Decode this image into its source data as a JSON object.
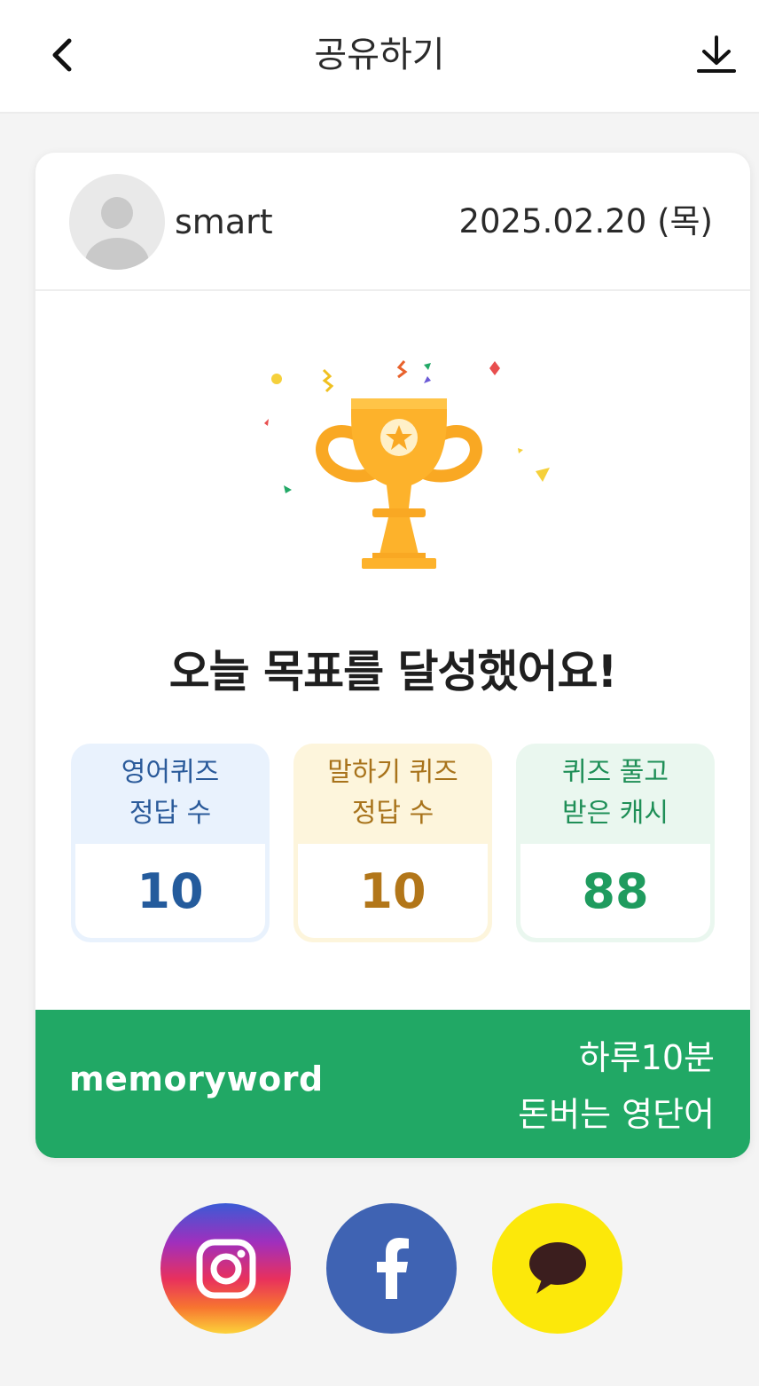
{
  "header": {
    "title": "공유하기",
    "back_icon": "chevron-left-icon",
    "download_icon": "download-icon"
  },
  "card": {
    "username": "smart",
    "date": "2025.02.20 (목)",
    "achievement": "오늘 목표를 달성했어요!",
    "stats": [
      {
        "label_line1": "영어퀴즈",
        "label_line2": "정답 수",
        "value": "10",
        "color": "#245b9c"
      },
      {
        "label_line1": "말하기 퀴즈",
        "label_line2": "정답 수",
        "value": "10",
        "color": "#b27619"
      },
      {
        "label_line1": "퀴즈 풀고",
        "label_line2": "받은 캐시",
        "value": "88",
        "color": "#1f9b5e"
      }
    ],
    "banner": {
      "brand": "memoryword",
      "slogan_line1": "하루10분",
      "slogan_line2": "돈버는 영단어",
      "color": "#21a865"
    }
  },
  "share": {
    "instagram_icon": "instagram-icon",
    "facebook_icon": "facebook-icon",
    "kakao_icon": "kakaotalk-icon"
  }
}
